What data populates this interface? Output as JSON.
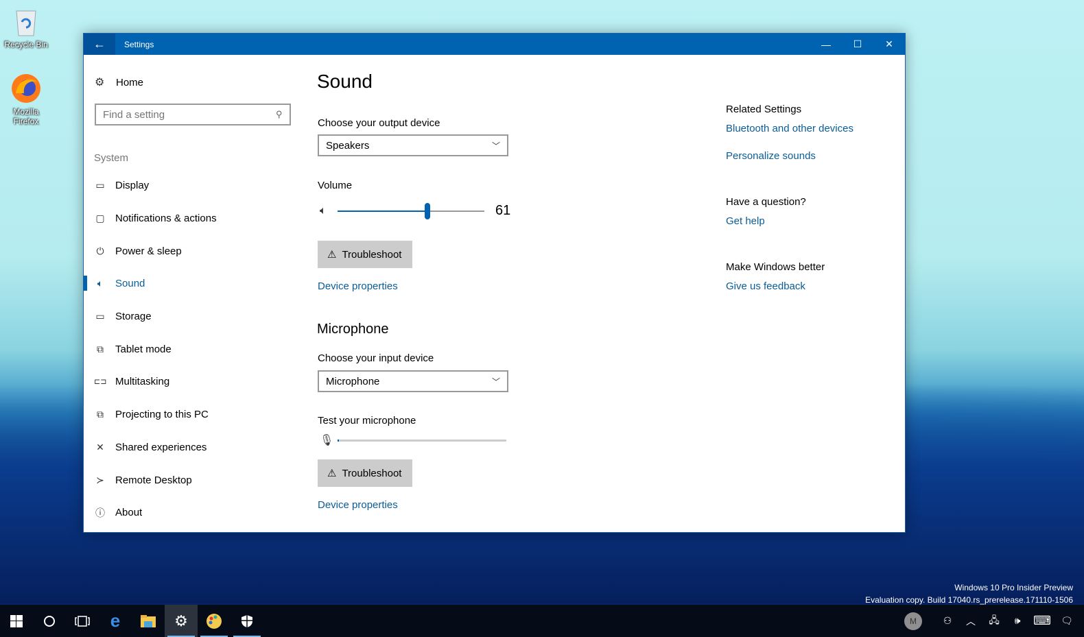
{
  "desktop": {
    "icons": [
      {
        "label": "Recycle Bin",
        "icon": "recycle-bin-icon"
      },
      {
        "label": "Mozilla Firefox",
        "icon": "firefox-icon"
      }
    ],
    "watermark": {
      "line1": "Windows 10 Pro Insider Preview",
      "line2": "Evaluation copy. Build 17040.rs_prerelease.171110-1506"
    }
  },
  "window": {
    "title": "Settings",
    "controls": {
      "minimize": "—",
      "maximize": "☐",
      "close": "✕"
    },
    "back_glyph": "←"
  },
  "nav": {
    "home_label": "Home",
    "search_placeholder": "Find a setting",
    "section_label": "System",
    "items": [
      {
        "label": "Display",
        "icon": "display-icon",
        "glyph": "▭"
      },
      {
        "label": "Notifications & actions",
        "icon": "notifications-icon",
        "glyph": "▢"
      },
      {
        "label": "Power & sleep",
        "icon": "power-icon",
        "glyph": "⏻"
      },
      {
        "label": "Sound",
        "icon": "sound-icon",
        "glyph": "🔊︎",
        "active": true
      },
      {
        "label": "Storage",
        "icon": "storage-icon",
        "glyph": "▭"
      },
      {
        "label": "Tablet mode",
        "icon": "tablet-mode-icon",
        "glyph": "⧉"
      },
      {
        "label": "Multitasking",
        "icon": "multitasking-icon",
        "glyph": "⊏⊐"
      },
      {
        "label": "Projecting to this PC",
        "icon": "projecting-icon",
        "glyph": "⧉"
      },
      {
        "label": "Shared experiences",
        "icon": "shared-experiences-icon",
        "glyph": "✕"
      },
      {
        "label": "Remote Desktop",
        "icon": "remote-desktop-icon",
        "glyph": "≻"
      },
      {
        "label": "About",
        "icon": "info-icon",
        "glyph": "ⓘ"
      }
    ]
  },
  "main": {
    "title": "Sound",
    "output": {
      "label": "Choose your output device",
      "selected": "Speakers",
      "volume_label": "Volume",
      "volume_value": 61,
      "volume_text": "61",
      "troubleshoot_label": "Troubleshoot",
      "device_properties_label": "Device properties"
    },
    "microphone": {
      "title": "Microphone",
      "label": "Choose your input device",
      "selected": "Microphone",
      "test_label": "Test your microphone",
      "level_percent": 1,
      "troubleshoot_label": "Troubleshoot",
      "device_properties_label": "Device properties"
    }
  },
  "related": {
    "related_heading": "Related Settings",
    "bluetooth_link": "Bluetooth and other devices",
    "personalize_link": "Personalize sounds",
    "question_heading": "Have a question?",
    "help_link": "Get help",
    "better_heading": "Make Windows better",
    "feedback_link": "Give us feedback"
  },
  "taskbar": {
    "apps": [
      {
        "name": "start-button",
        "glyph": "⊞"
      },
      {
        "name": "cortana-button",
        "glyph": "○"
      },
      {
        "name": "task-view-button",
        "glyph": "⧠"
      },
      {
        "name": "edge-app",
        "glyph": "e"
      },
      {
        "name": "file-explorer-app",
        "glyph": "🗀"
      },
      {
        "name": "settings-app",
        "glyph": "⚙"
      },
      {
        "name": "paint-app",
        "glyph": "🎨"
      },
      {
        "name": "defender-app",
        "glyph": "⛉"
      }
    ],
    "avatar_letter": "M",
    "tray": {
      "people": "⚇",
      "chevron": "︿",
      "network": "🖧",
      "volume": "🕪",
      "keyboard": "⌨",
      "action_center": "🗨"
    }
  }
}
